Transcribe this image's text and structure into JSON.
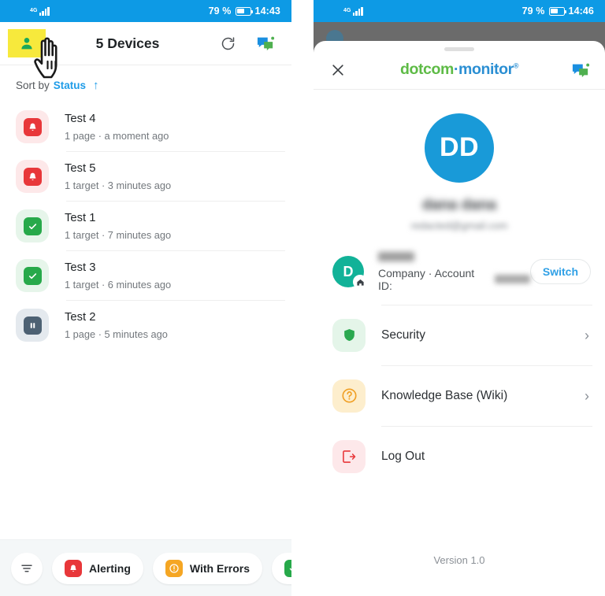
{
  "left": {
    "statusbar": {
      "network": "4G",
      "battery_percent": "79 %",
      "time": "14:43"
    },
    "header": {
      "profile_icon": "person-icon",
      "title": "5 Devices",
      "refresh_icon": "refresh-icon",
      "chat_icon": "chat-icon"
    },
    "sort": {
      "label": "Sort by",
      "value": "Status",
      "direction_icon": "arrow-up-icon",
      "direction": "↑"
    },
    "devices": [
      {
        "name": "Test 4",
        "subtitle": "1 page · a moment ago",
        "status": "alerting",
        "icon": "bell-icon"
      },
      {
        "name": "Test 5",
        "subtitle": "1 target · 3 minutes ago",
        "status": "alerting",
        "icon": "bell-icon"
      },
      {
        "name": "Test 1",
        "subtitle": "1 target · 7 minutes ago",
        "status": "ok",
        "icon": "check-icon"
      },
      {
        "name": "Test 3",
        "subtitle": "1 target · 6 minutes ago",
        "status": "ok",
        "icon": "check-icon"
      },
      {
        "name": "Test 2",
        "subtitle": "1 page · 5 minutes ago",
        "status": "paused",
        "icon": "pause-icon"
      }
    ],
    "filters": [
      {
        "label": "",
        "icon": "filter-icon",
        "shape": "round"
      },
      {
        "label": "Alerting",
        "icon": "bell-icon",
        "shape": "pill"
      },
      {
        "label": "With Errors",
        "icon": "warning-icon",
        "shape": "pill"
      },
      {
        "label": "",
        "icon": "check-icon",
        "shape": "pill-cut"
      }
    ]
  },
  "right": {
    "statusbar": {
      "network": "4G",
      "battery_percent": "79 %",
      "time": "14:46"
    },
    "sheet": {
      "close_icon": "close-icon",
      "brand_part1": "dotcom",
      "brand_part2": "·monitor",
      "brand_mark": "®",
      "chat_icon": "chat-icon"
    },
    "profile": {
      "initials": "DD",
      "name": "dana dana",
      "email": "redacted@gmail.com"
    },
    "account": {
      "avatar_initial": "D",
      "home_icon": "home-icon",
      "company_name": "",
      "meta": "Company · Account ID:",
      "account_id": "",
      "switch_label": "Switch"
    },
    "menu": [
      {
        "label": "Security",
        "icon": "shield-icon",
        "chevron": "›"
      },
      {
        "label": "Knowledge Base (Wiki)",
        "icon": "question-icon",
        "chevron": "›"
      },
      {
        "label": "Log Out",
        "icon": "logout-icon",
        "chevron": ""
      }
    ],
    "version": "Version 1.0"
  },
  "colors": {
    "status_blue": "#0d9ae5",
    "accent_blue": "#1f9ce8",
    "brand_green": "#5ebb46",
    "brand_blue": "#2b8fd3",
    "alert_red": "#e8373a",
    "ok_green": "#27a94a",
    "warn_orange": "#f5a623",
    "paused_gray": "#4d6173",
    "highlight_yellow": "#f7e93c",
    "teal": "#12b298"
  }
}
